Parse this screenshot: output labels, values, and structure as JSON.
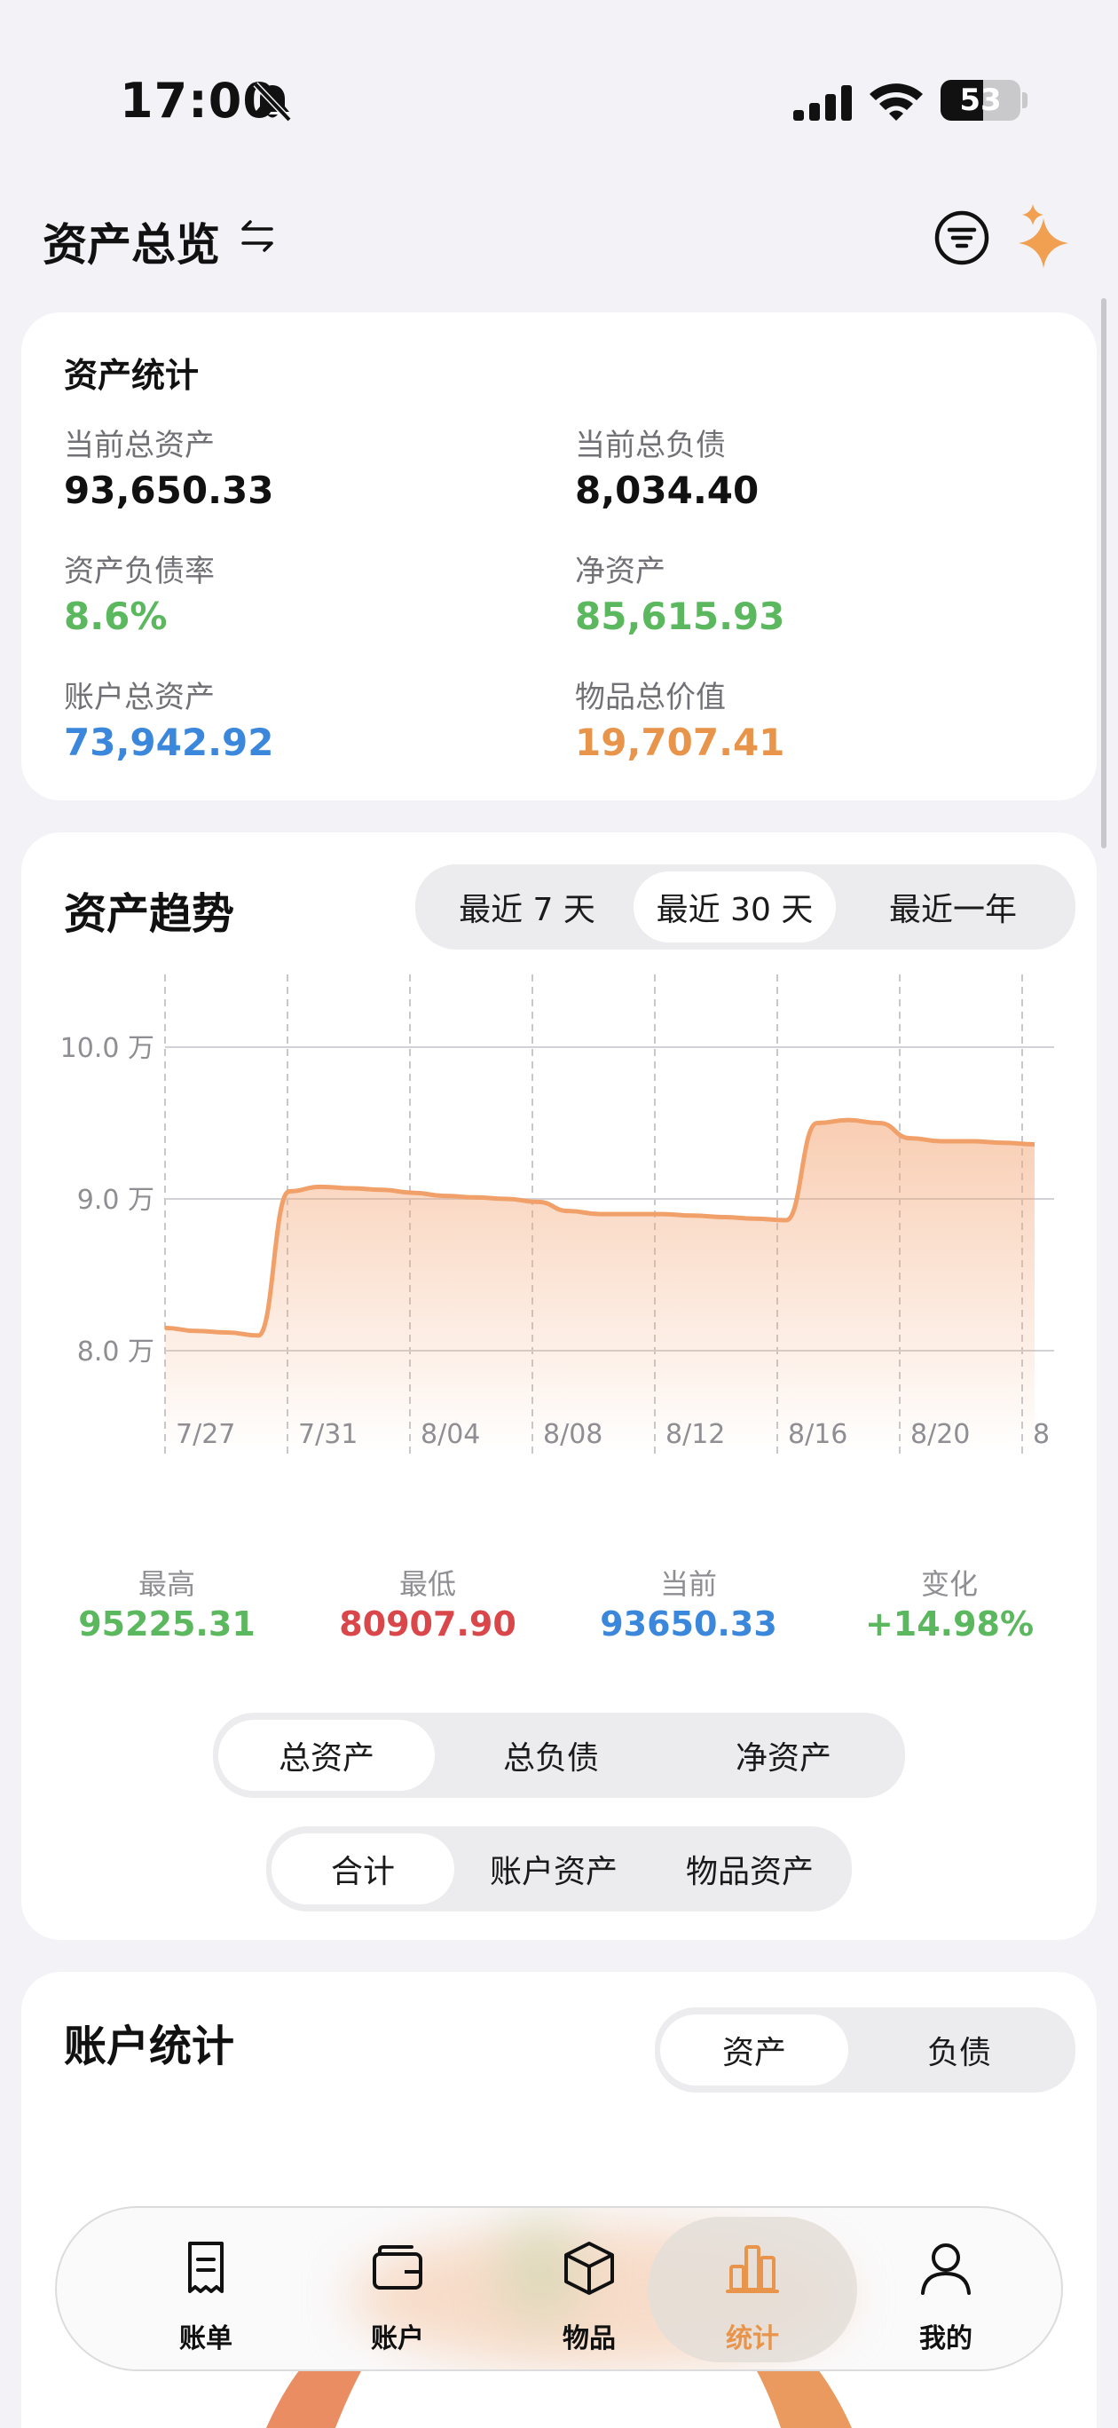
{
  "status": {
    "time": "17:00",
    "battery": "53",
    "battery_level": 0.53
  },
  "header": {
    "title": "资产总览"
  },
  "colors": {
    "green": "#5cb85f",
    "red": "#d9474a",
    "blue": "#3b87db",
    "orange": "#e8944a",
    "accent": "#f0a068"
  },
  "stats": {
    "title": "资产统计",
    "total_assets_label": "当前总资产",
    "total_assets": "93,650.33",
    "total_liab_label": "当前总负债",
    "total_liab": "8,034.40",
    "ratio_label": "资产负债率",
    "ratio": "8.6%",
    "net_label": "净资产",
    "net": "85,615.93",
    "account_label": "账户总资产",
    "account": "73,942.92",
    "goods_label": "物品总价值",
    "goods": "19,707.41"
  },
  "trend": {
    "title": "资产趋势",
    "ranges": [
      "最近 7 天",
      "最近 30 天",
      "最近一年"
    ],
    "range_active": 1,
    "summary": [
      {
        "label": "最高",
        "value": "95225.31"
      },
      {
        "label": "最低",
        "value": "80907.90"
      },
      {
        "label": "当前",
        "value": "93650.33"
      },
      {
        "label": "变化",
        "value": "+14.98%"
      }
    ],
    "metric_tabs": [
      "总资产",
      "总负债",
      "净资产"
    ],
    "metric_active": 0,
    "source_tabs": [
      "合计",
      "账户资产",
      "物品资产"
    ],
    "source_active": 0
  },
  "chart_data": {
    "type": "area",
    "x_ticks": [
      "7/27",
      "7/31",
      "8/04",
      "8/08",
      "8/12",
      "8/16",
      "8/20",
      "8"
    ],
    "y_ticks": [
      "10.0 万",
      "9.0 万",
      "8.0 万"
    ],
    "ylim": [
      8.0,
      10.0
    ],
    "grid": true,
    "series": [
      {
        "x": [
          "7/27",
          "7/28",
          "7/29",
          "7/30",
          "7/31",
          "8/01",
          "8/02",
          "8/03",
          "8/04",
          "8/05",
          "8/06",
          "8/07",
          "8/08",
          "8/09",
          "8/10",
          "8/11",
          "8/12",
          "8/13",
          "8/14",
          "8/15",
          "8/16",
          "8/17",
          "8/18",
          "8/19",
          "8/20",
          "8/21",
          "8/22",
          "8/23",
          "8/24"
        ],
        "values": [
          8.15,
          8.13,
          8.12,
          8.1,
          9.05,
          9.08,
          9.07,
          9.06,
          9.04,
          9.02,
          9.01,
          9.0,
          8.98,
          8.92,
          8.9,
          8.9,
          8.9,
          8.89,
          8.88,
          8.87,
          8.86,
          9.5,
          9.52,
          9.5,
          9.4,
          9.38,
          9.38,
          9.37,
          9.36
        ]
      }
    ]
  },
  "accounts": {
    "title": "账户统计",
    "tabs": [
      "资产",
      "负债"
    ],
    "tab_active": 0
  },
  "tabbar": {
    "items": [
      {
        "label": "账单",
        "icon": "receipt-icon"
      },
      {
        "label": "账户",
        "icon": "wallet-icon"
      },
      {
        "label": "物品",
        "icon": "box-icon"
      },
      {
        "label": "统计",
        "icon": "chart-icon"
      },
      {
        "label": "我的",
        "icon": "person-icon"
      }
    ],
    "active": 3
  }
}
